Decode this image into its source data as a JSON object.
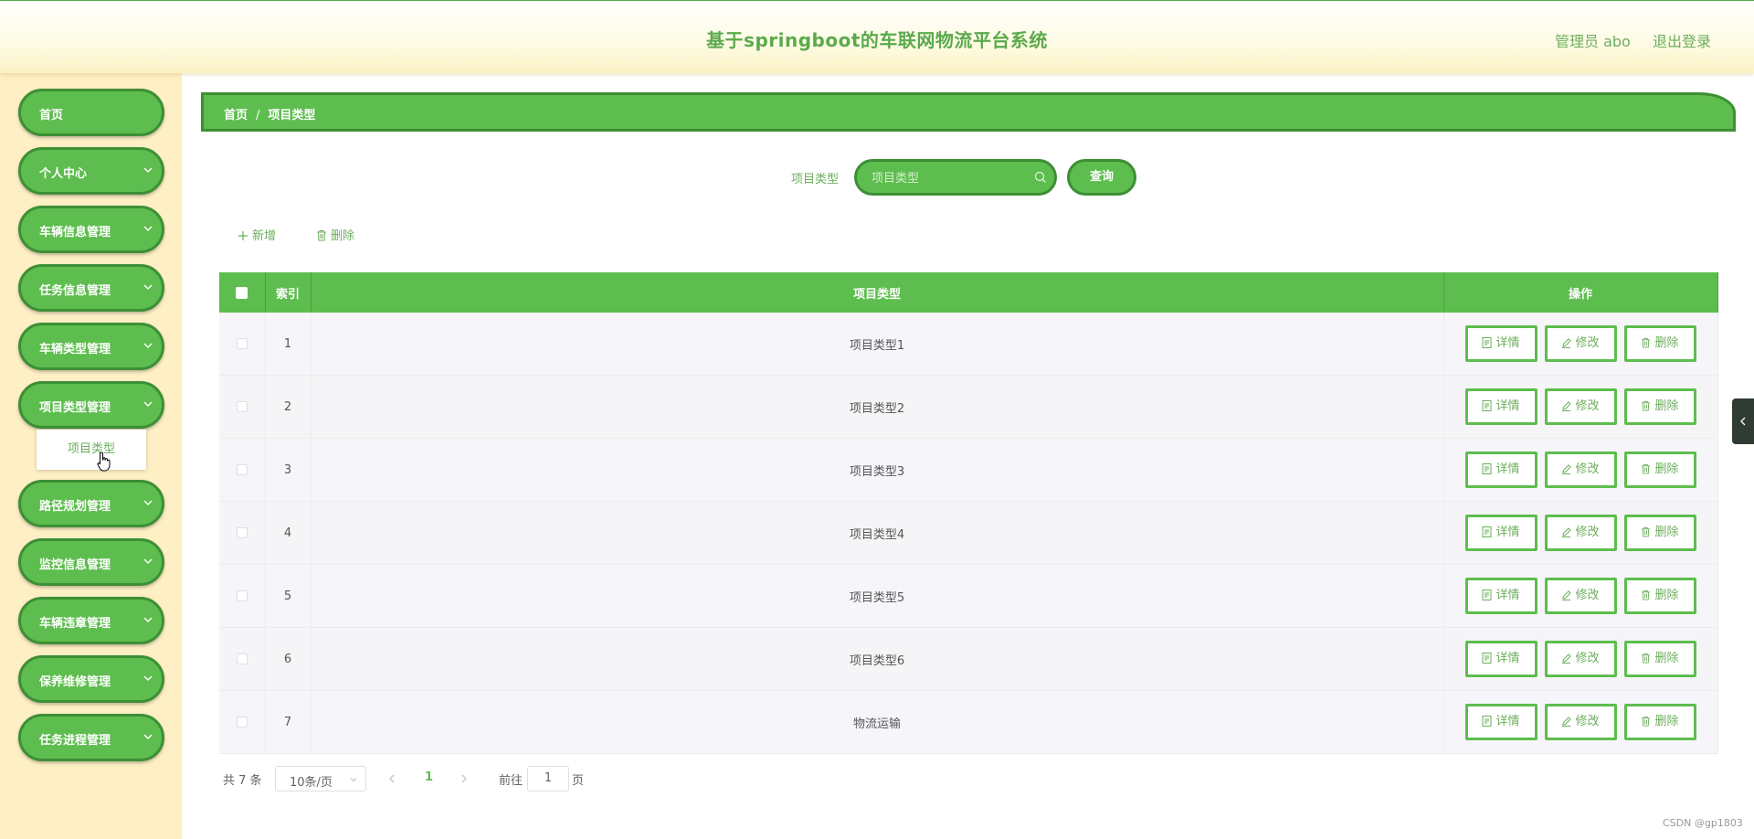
{
  "header": {
    "title": "基于springboot的车联网物流平台系统",
    "user": "管理员 abo",
    "logout": "退出登录"
  },
  "sidebar": {
    "items": [
      {
        "label": "首页",
        "icon": null
      },
      {
        "label": "个人中心",
        "icon": "chevron-down-icon"
      },
      {
        "label": "车辆信息管理",
        "icon": "chevron-down-icon"
      },
      {
        "label": "任务信息管理",
        "icon": "chevron-down-icon"
      },
      {
        "label": "车辆类型管理",
        "icon": "chevron-down-icon"
      },
      {
        "label": "项目类型管理",
        "icon": "chevron-down-icon"
      },
      {
        "label": "路径规划管理",
        "icon": "chevron-down-icon"
      },
      {
        "label": "监控信息管理",
        "icon": "chevron-down-icon"
      },
      {
        "label": "车辆违章管理",
        "icon": "chevron-down-icon"
      },
      {
        "label": "保养维修管理",
        "icon": "chevron-down-icon"
      },
      {
        "label": "任务进程管理",
        "icon": "chevron-down-icon"
      }
    ],
    "submenu": "项目类型"
  },
  "breadcrumb": {
    "home": "首页",
    "separator": "/",
    "current": "项目类型"
  },
  "search": {
    "label": "项目类型",
    "placeholder": "项目类型",
    "button": "查询"
  },
  "toolbar": {
    "add": "新增",
    "delete": "删除"
  },
  "table": {
    "headers": [
      "索引",
      "项目类型",
      "操作"
    ],
    "rows": [
      {
        "index": "1",
        "type": "项目类型1"
      },
      {
        "index": "2",
        "type": "项目类型2"
      },
      {
        "index": "3",
        "type": "项目类型3"
      },
      {
        "index": "4",
        "type": "项目类型4"
      },
      {
        "index": "5",
        "type": "项目类型5"
      },
      {
        "index": "6",
        "type": "项目类型6"
      },
      {
        "index": "7",
        "type": "物流运输"
      }
    ],
    "actions": {
      "detail": "详情",
      "edit": "修改",
      "delete": "删除"
    }
  },
  "pagination": {
    "total": "共 7 条",
    "page_size": "10条/页",
    "current_page": "1",
    "goto_label": "前往",
    "goto_value": "1",
    "page_suffix": "页"
  },
  "watermark": "CSDN @gp1803",
  "colors": {
    "primary": "#5dbd4e",
    "primary_dark": "#3d8f35",
    "text_green": "#6cae5c",
    "sidebar_bg": "#feefc4"
  }
}
